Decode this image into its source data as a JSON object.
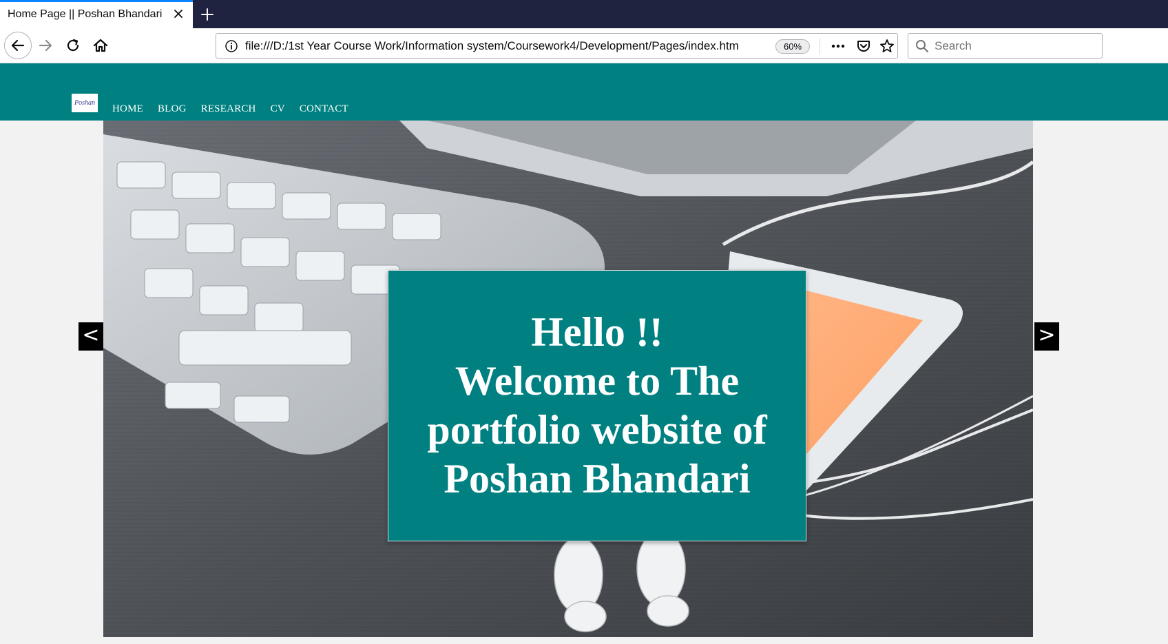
{
  "browser": {
    "tab_title": "Home Page || Poshan Bhandari",
    "url": "file:///D:/1st Year Course Work/Information system/Coursework4/Development/Pages/index.htm",
    "zoom": "60%",
    "search_placeholder": "Search"
  },
  "site": {
    "logo_text": "Poshan",
    "nav": [
      "HOME",
      "BLOG",
      "RESEARCH",
      "CV",
      "CONTACT"
    ],
    "slider": {
      "prev": "<",
      "next": ">",
      "welcome_lines": [
        "Hello !!",
        "Welcome to The",
        "portfolio website of",
        "Poshan Bhandari"
      ]
    }
  },
  "colors": {
    "accent": "#008080",
    "tabstrip": "#202340",
    "tab_highlight": "#0a84ff"
  },
  "icons": [
    "close-icon",
    "plus-icon",
    "back-arrow-icon",
    "forward-arrow-icon",
    "reload-icon",
    "home-icon",
    "info-icon",
    "more-dots-icon",
    "pocket-icon",
    "star-icon",
    "search-icon"
  ]
}
